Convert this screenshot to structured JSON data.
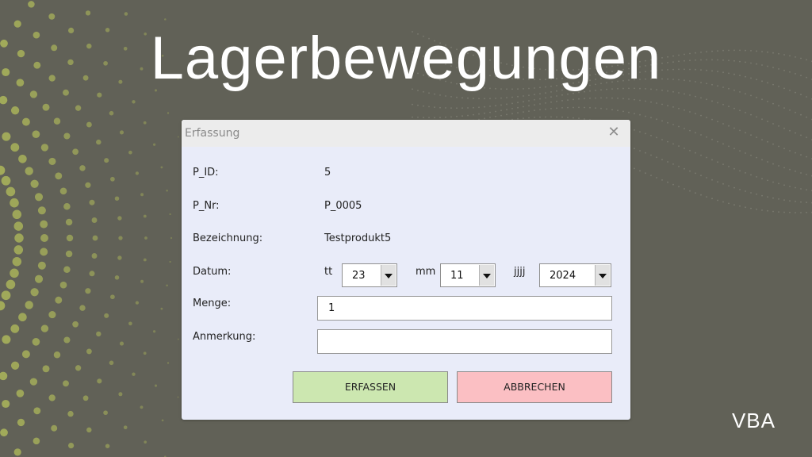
{
  "slide": {
    "title": "Lagerbewegungen",
    "brand": "VBA",
    "colors": {
      "background": "#616157",
      "dots": "#a5ae5a",
      "dialog": "#e9ecf9"
    }
  },
  "dialog": {
    "title": "Erfassung",
    "close_icon": "close-icon",
    "fields": {
      "p_id": {
        "label": "P_ID:",
        "value": "5"
      },
      "p_nr": {
        "label": "P_Nr:",
        "value": "P_0005"
      },
      "bezeichnung": {
        "label": "Bezeichnung:",
        "value": "Testprodukt5"
      },
      "datum": {
        "label": "Datum:",
        "day_label": "tt",
        "day_value": "23",
        "month_label": "mm",
        "month_value": "11",
        "year_label": "jjjj",
        "year_value": "2024"
      },
      "menge": {
        "label": "Menge:",
        "value": "1"
      },
      "anmerkung": {
        "label": "Anmerkung:",
        "value": ""
      }
    },
    "buttons": {
      "submit": {
        "label": "ERFASSEN",
        "color": "#cce7b0"
      },
      "cancel": {
        "label": "ABBRECHEN",
        "color": "#fbbfc3"
      }
    }
  }
}
